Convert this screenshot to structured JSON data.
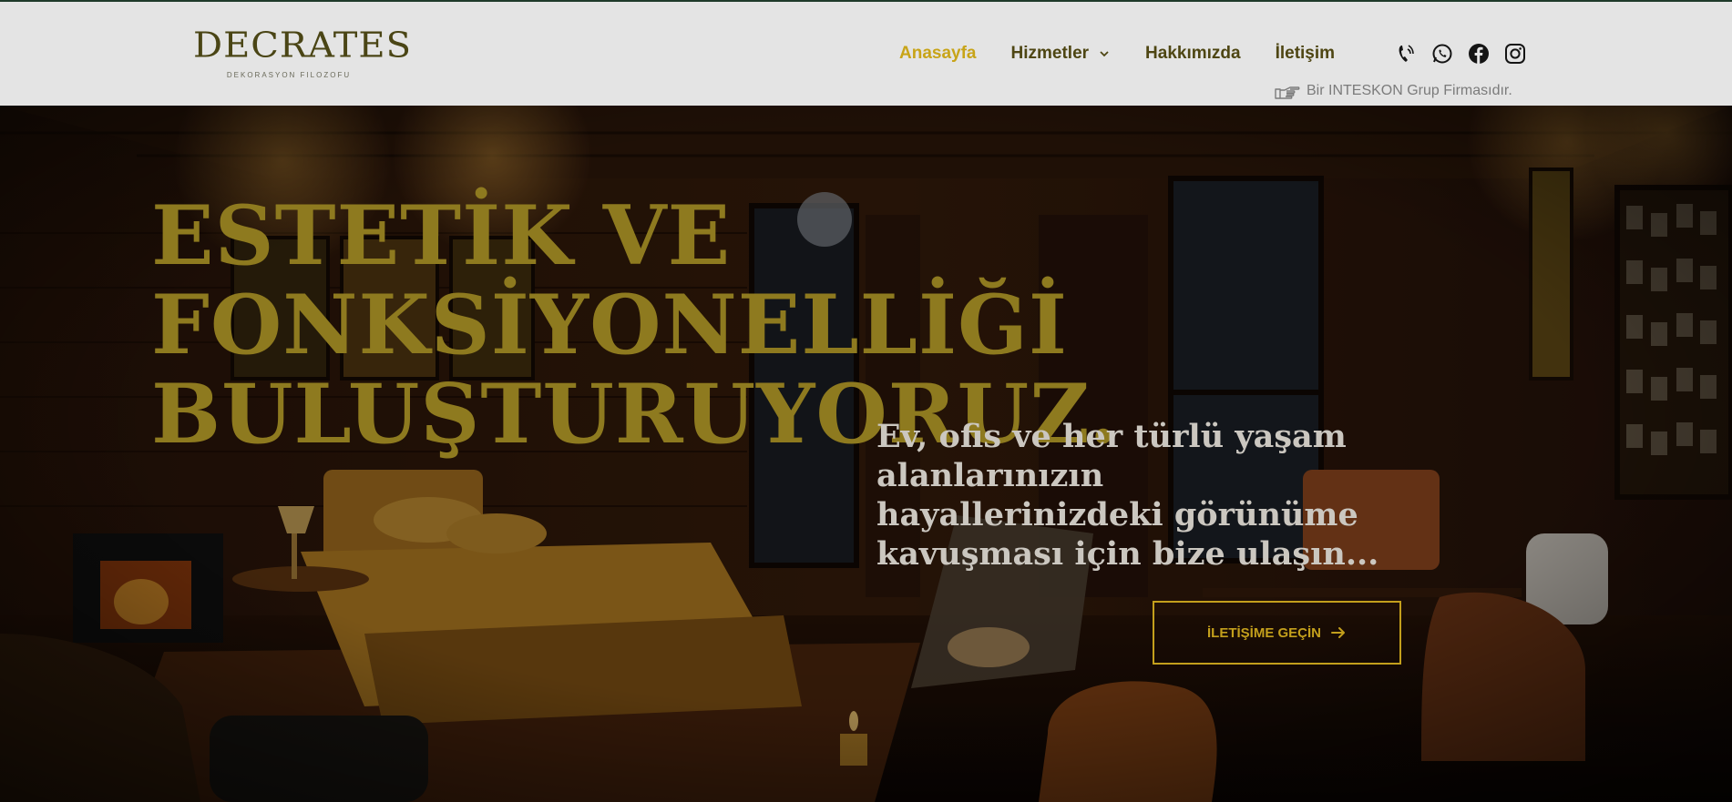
{
  "brand": {
    "name": "DECRATES",
    "tagline": "DEKORASYON FILOZOFU"
  },
  "nav": {
    "items": [
      {
        "label": "Anasayfa",
        "active": true
      },
      {
        "label": "Hizmetler",
        "has_dropdown": true
      },
      {
        "label": "Hakkımızda"
      },
      {
        "label": "İletişim"
      }
    ]
  },
  "social": {
    "icons": [
      "phone-icon",
      "whatsapp-icon",
      "facebook-icon",
      "instagram-icon"
    ]
  },
  "group_note": {
    "icon": "pointing-hand-icon",
    "text": "Bir INTESKON Grup Firmasıdır."
  },
  "hero": {
    "headline": "ESTETİK VE\nFONKSİYONELLİĞİ\nBULUŞTURUYORUZ.",
    "subtext": "Ev, ofis ve her türlü yaşam alanlarınızın hayallerinizdeki görünüme kavuşması için bize ulaşın...",
    "cta_label": "İLETİŞİME GEÇİN"
  },
  "colors": {
    "accent_gold": "#c8a418",
    "headline_gold": "#8e7a1f",
    "nav_text": "#4e4613",
    "header_bg": "#e4e4e4"
  }
}
